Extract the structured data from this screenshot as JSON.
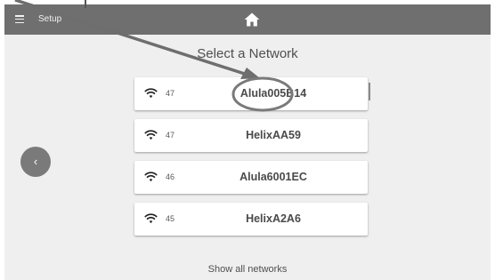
{
  "app_bar": {
    "menu_icon": "hamburger-menu-icon",
    "label": "Setup",
    "home_icon": "home-icon",
    "background": "#6f6f6f"
  },
  "main": {
    "title": "Select a Network",
    "back_icon": "chevron-left-icon",
    "back_label": "‹",
    "networks": [
      {
        "signal": "47",
        "ssid": "Alula005B14",
        "icon": "wifi-icon"
      },
      {
        "signal": "47",
        "ssid": "HelixAA59",
        "icon": "wifi-icon"
      },
      {
        "signal": "46",
        "ssid": "Alula6001EC",
        "icon": "wifi-icon"
      },
      {
        "signal": "45",
        "ssid": "HelixA2A6",
        "icon": "wifi-icon"
      }
    ],
    "show_all": "Show all networks"
  },
  "annotation": {
    "pointer_color": "#6e6e6e",
    "highlight": "circle around first network name"
  }
}
